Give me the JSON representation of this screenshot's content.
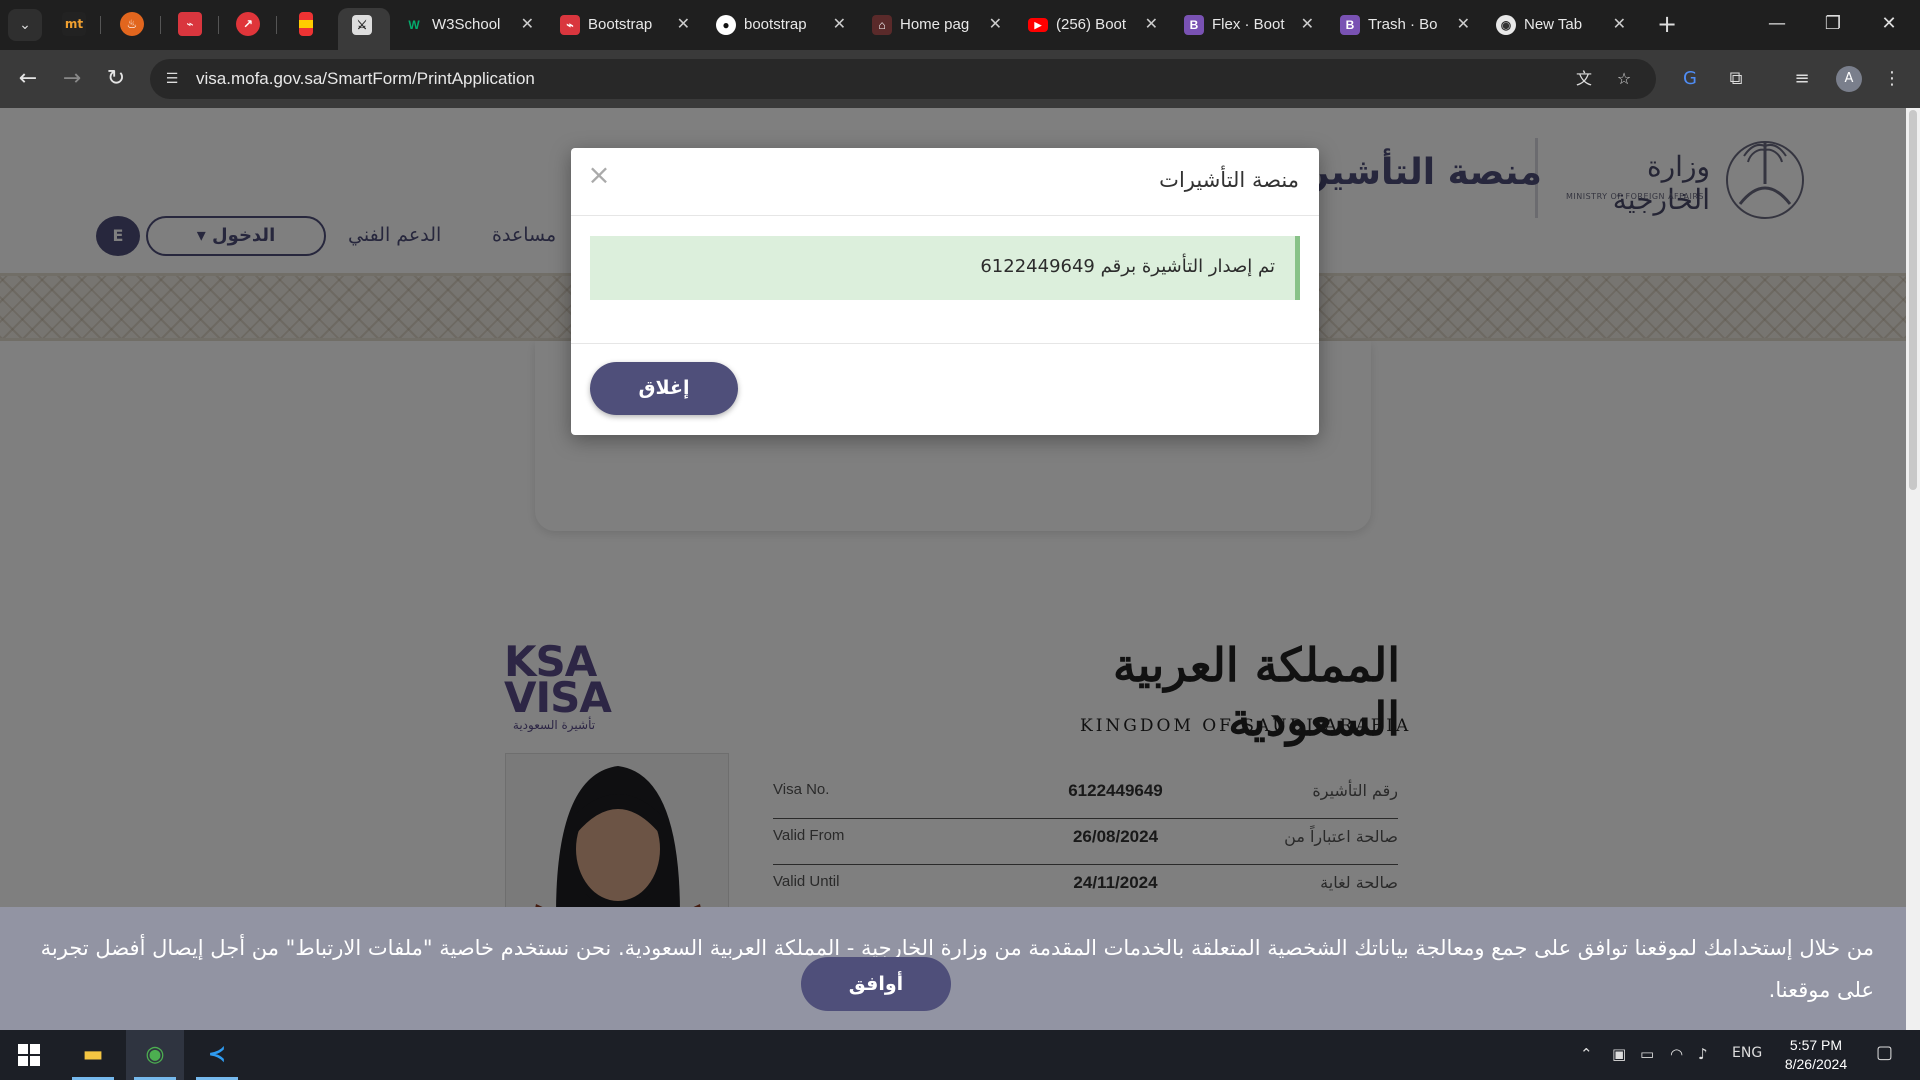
{
  "browser": {
    "tabs": [
      {
        "label": "W3School",
        "icon": "w3schools-icon"
      },
      {
        "label": "Bootstrap",
        "icon": "bootstrap-red-icon"
      },
      {
        "label": "bootstrap",
        "icon": "github-icon"
      },
      {
        "label": "Home pag",
        "icon": "home-icon"
      },
      {
        "label": "(256) Boot",
        "icon": "youtube-icon"
      },
      {
        "label": "Flex · Boot",
        "icon": "bootstrap-icon"
      },
      {
        "label": "Trash · Bo",
        "icon": "bootstrap-icon"
      },
      {
        "label": "New Tab",
        "icon": "chrome-icon"
      }
    ],
    "pinned_badges": [
      "mt"
    ],
    "url": "visa.mofa.gov.sa/SmartForm/PrintApplication",
    "profile_initial": "A"
  },
  "site": {
    "platform_title": "منصة التأشيرات",
    "mofa_logo_text": "وزارة الخارجية",
    "mofa_logo_sub": "MINISTRY OF FOREIGN AFFAIRS",
    "nav": {
      "help": "مساعدة",
      "support": "الدعم الفني",
      "login": "الدخول ▾",
      "lang": "E"
    }
  },
  "visa_doc": {
    "ksa_logo_line1": "KSA",
    "ksa_logo_line2": "VISA",
    "ksa_logo_sub": "تأشيرة السعودية",
    "kingdom_ar": "المملكة العربية السعودية",
    "kingdom_en": "KINGDOM OF SAUDI ARABIA",
    "rows": [
      {
        "en": "Visa No.",
        "value": "6122449649",
        "ar": "رقم التأشيرة"
      },
      {
        "en": "Valid From",
        "value": "26/08/2024",
        "ar": "صالحة اعتباراً من"
      },
      {
        "en": "Valid Until",
        "value": "24/11/2024",
        "ar": "صالحة لغاية"
      }
    ]
  },
  "modal": {
    "title": "منصة التأشيرات",
    "close_symbol": "×",
    "message": "تم إصدار التأشيرة برقم 6122449649",
    "close_button": "إغلاق"
  },
  "cookie": {
    "text": "من خلال إستخدامك لموقعنا توافق على جمع ومعالجة بياناتك الشخصية المتعلقة بالخدمات المقدمة من وزارة الخارجية - المملكة العربية السعودية. نحن نستخدم خاصية \"ملفات الارتباط\" من أجل إيصال أفضل تجربة على موقعنا.",
    "accept": "أوافق"
  },
  "taskbar": {
    "lang": "ENG",
    "time": "5:57 PM",
    "date": "8/26/2024"
  },
  "colors": {
    "brand_purple": "#4f4f7a",
    "alert_green": "#dcefdc",
    "cookie_bar": "#9294a3"
  }
}
